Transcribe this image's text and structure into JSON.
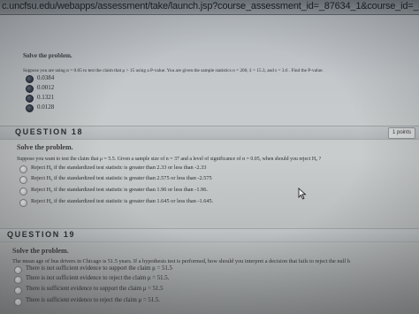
{
  "browser": {
    "url": "c.uncfsu.edu/webapps/assessment/take/launch.jsp?course_assessment_id=_87634_1&course_id=_8091182_1&content_id=_1249007_1&step="
  },
  "q17": {
    "solve": "Solve the problem.",
    "prompt": "Suppose you are using α = 0.05 to test the claim that μ > 15 using a P-value. You are given the sample statistics n = 200, x̄ = 15.3, and s = 3.6 . Find the P-value.",
    "options": [
      "0.0384",
      "0.0012",
      "0.1321",
      "0.0128"
    ],
    "selected_index": 0
  },
  "q18": {
    "number": "QUESTION 18",
    "points": "1 points",
    "solve": "Solve the problem.",
    "prompt": "Suppose you want to test the claim that μ = 5.5. Given a sample size of n = 37 and a level of significance of α = 0.05, when should you reject H₀ ?",
    "options": [
      "Reject H₀ if the standardized test statistic is greater than 2.33 or less than -2.33",
      "Reject H₀ if the standardized test statistic is greater than 2.575 or less than -2.575",
      "Reject H₀ if the standardized test statistic is greater than 1.96 or less than -1.96.",
      "Reject H₀ if the standardized test statistic is greater than 1.645 or less than -1.645."
    ]
  },
  "q19": {
    "number": "QUESTION 19",
    "solve": "Solve the problem.",
    "prompt": "The mean age of bus drivers in Chicago is 51.5 years. If a hypothesis test is performed, how should you interpret a decision that fails to reject the null h",
    "options": [
      "There is not sufficient evidence to support the claim μ = 51.5",
      "There is not sufficient evidence to reject the claim μ = 51.5.",
      "There is sufficient evidence to support the claim μ = 51.5",
      "There is sufficient evidence to reject the claim μ = 51.5."
    ]
  }
}
